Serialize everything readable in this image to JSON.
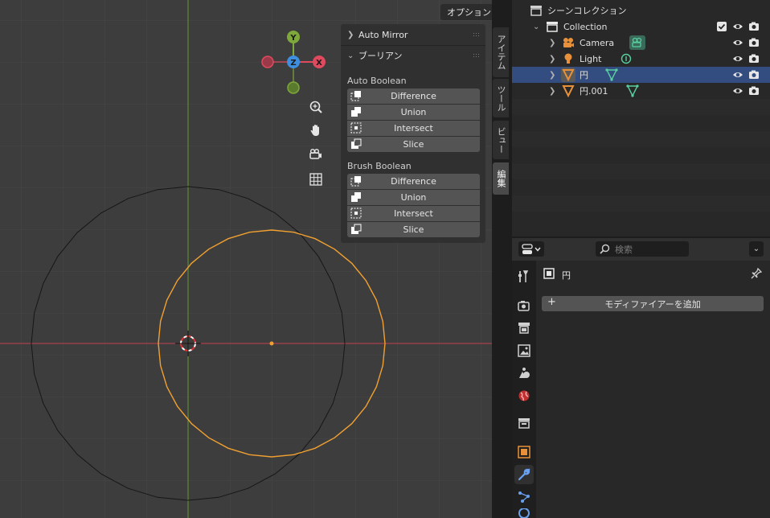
{
  "viewport": {
    "options_label": "オプション",
    "gizmo": {
      "y": "Y",
      "z": "Z",
      "x": "X"
    },
    "nav_icons": [
      "zoom-icon",
      "hand-pan-icon",
      "camera-view-icon",
      "grid-ortho-icon"
    ],
    "colors": {
      "bg": "#3d3d3d",
      "x_axis": "#b04050",
      "y_axis": "#6a9a3a",
      "selected_outline": "#f0a030",
      "grid": "#474747"
    }
  },
  "npanel": {
    "auto_mirror": "Auto Mirror",
    "boolean_header": "ブーリアン",
    "auto_boolean_label": "Auto Boolean",
    "brush_boolean_label": "Brush Boolean",
    "auto_ops": [
      "Difference",
      "Union",
      "Intersect",
      "Slice"
    ],
    "brush_ops": [
      "Difference",
      "Union",
      "Intersect",
      "Slice"
    ]
  },
  "vtabs": [
    "アイテム",
    "ツール",
    "ビュー",
    "編集"
  ],
  "outliner": {
    "scene_collection": "シーンコレクション",
    "collection": "Collection",
    "items": [
      {
        "label": "Camera",
        "selected": false
      },
      {
        "label": "Light",
        "selected": false
      },
      {
        "label": "円",
        "selected": true
      },
      {
        "label": "円.001",
        "selected": false
      }
    ]
  },
  "properties": {
    "search_placeholder": "検索",
    "object_name": "円",
    "add_modifier": "モディファイアーを追加",
    "active_tab": "modifier",
    "accent": "#4a80d8"
  }
}
